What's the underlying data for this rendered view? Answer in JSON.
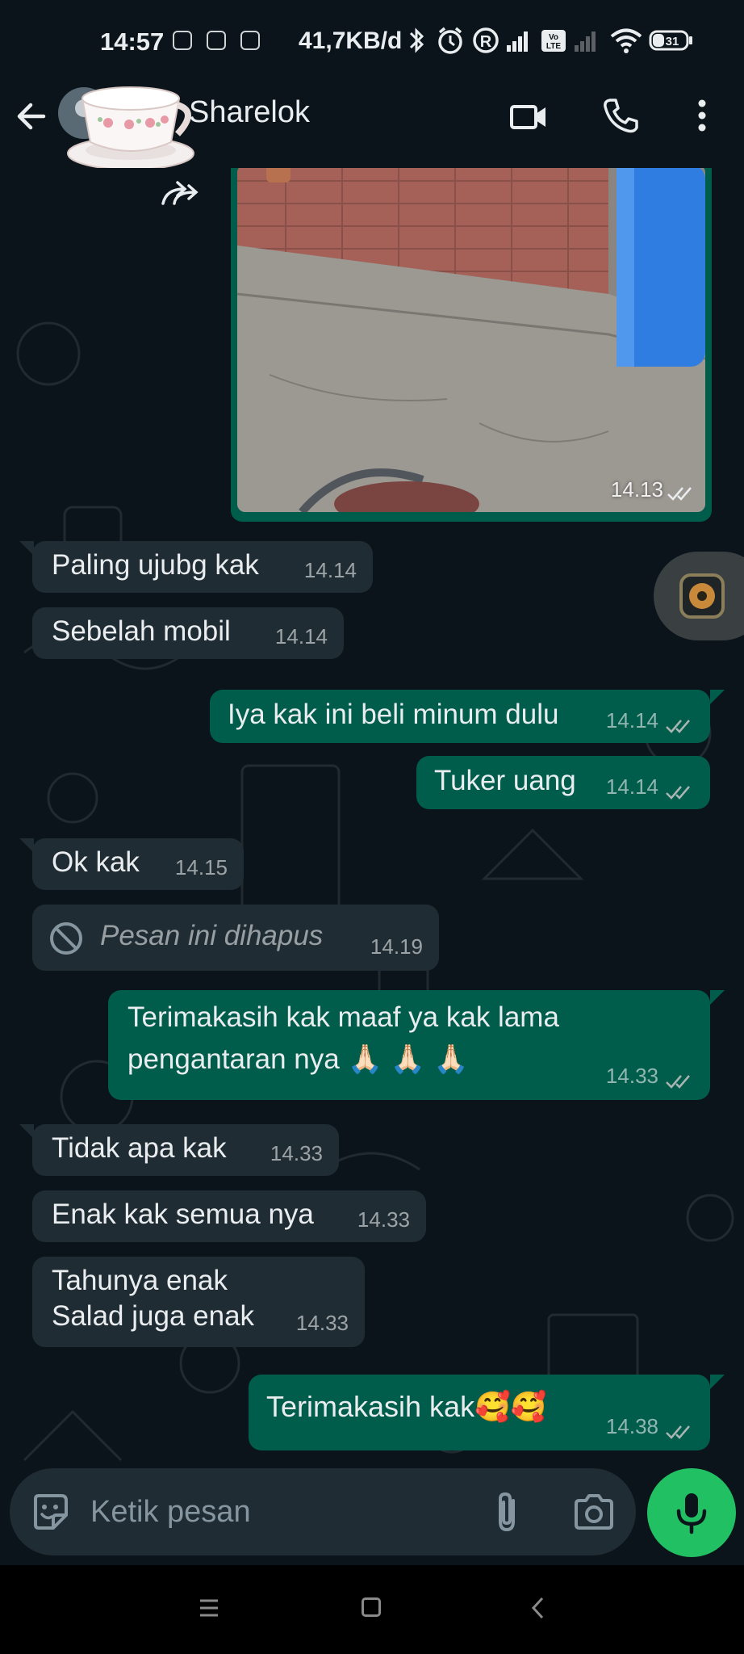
{
  "status_bar": {
    "time": "14:57",
    "net_speed": "41,7KB/d",
    "battery": "31"
  },
  "header": {
    "contact_name": "Sharelok"
  },
  "messages": [
    {
      "id": "photo",
      "type": "image",
      "time": "14.13",
      "direction": "outgoing"
    },
    {
      "id": "m1",
      "text": "Paling ujubg kak",
      "time": "14.14",
      "direction": "incoming"
    },
    {
      "id": "m2",
      "text": "Sebelah mobil",
      "time": "14.14",
      "direction": "incoming"
    },
    {
      "id": "m3",
      "text": "Iya kak ini beli minum dulu",
      "time": "14.14",
      "direction": "outgoing"
    },
    {
      "id": "m4",
      "text": "Tuker uang",
      "time": "14.14",
      "direction": "outgoing"
    },
    {
      "id": "m5",
      "text": "Ok kak",
      "time": "14.15",
      "direction": "incoming"
    },
    {
      "id": "m6",
      "text": "Pesan ini dihapus",
      "time": "14.19",
      "direction": "incoming",
      "deleted": true
    },
    {
      "id": "m7",
      "line1": "Terimakasih kak maaf ya kak lama",
      "line2": "pengantaran nya 🙏🏻 🙏🏻 🙏🏻",
      "time": "14.33",
      "direction": "outgoing"
    },
    {
      "id": "m8",
      "text": "Tidak apa kak",
      "time": "14.33",
      "direction": "incoming"
    },
    {
      "id": "m9",
      "text": "Enak kak semua nya",
      "time": "14.33",
      "direction": "incoming"
    },
    {
      "id": "m10",
      "line1": "Tahunya enak",
      "line2": "Salad juga enak",
      "time": "14.33",
      "direction": "incoming"
    },
    {
      "id": "m11",
      "text": "Terimakasih kak🥰🥰",
      "time": "14.38",
      "direction": "outgoing"
    }
  ],
  "input": {
    "placeholder": "Ketik pesan"
  },
  "colors": {
    "background": "#0b141a",
    "incoming_bubble": "#202c33",
    "outgoing_bubble": "#005c4b",
    "mic_button": "#21c063"
  }
}
